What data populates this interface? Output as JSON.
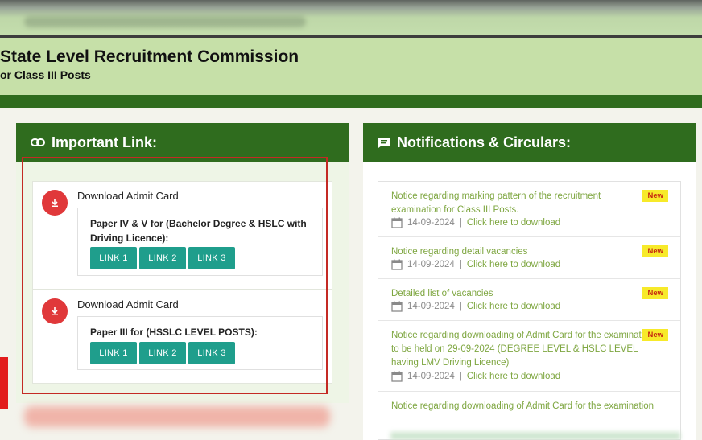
{
  "header": {
    "title": "State Level Recruitment Commission",
    "subtitle": "or Class III Posts"
  },
  "left_panel": {
    "heading": "Important Link:",
    "cards": [
      {
        "title": "Download Admit Card",
        "description": "Paper IV & V for (Bachelor Degree & HSLC with Driving Licence):",
        "links": [
          "LINK 1",
          "LINK 2",
          "LINK 3"
        ]
      },
      {
        "title": "Download Admit Card",
        "description": "Paper III for (HSSLC LEVEL POSTS):",
        "links": [
          "LINK 1",
          "LINK 2",
          "LINK 3"
        ]
      }
    ]
  },
  "right_panel": {
    "heading": "Notifications & Circulars:",
    "notices": [
      {
        "text": "Notice regarding marking pattern of the recruitment examination for Class III Posts.",
        "badge": "New",
        "date": "14-09-2024",
        "separator": "|",
        "link": "Click here to download"
      },
      {
        "text": "Notice regarding detail vacancies",
        "badge": "New",
        "date": "14-09-2024",
        "separator": "|",
        "link": "Click here to download"
      },
      {
        "text": "Detailed list of vacancies",
        "badge": "New",
        "date": "14-09-2024",
        "separator": "|",
        "link": "Click here to download"
      },
      {
        "text": "Notice regarding downloading of Admit Card for the examination to be held on 29-09-2024 (DEGREE LEVEL & HSLC LEVEL having LMV Driving Licence)",
        "badge": "New",
        "date": "14-09-2024",
        "separator": "|",
        "link": "Click here to download"
      },
      {
        "text": "Notice regarding downloading of Admit Card for the examination"
      }
    ]
  },
  "colors": {
    "header_bg": "#c6e0a8",
    "panel_head": "#2f6c1e",
    "button": "#1f9e8c",
    "highlight": "#c42a24",
    "notice_text": "#7ea640",
    "badge_bg": "#f7ea2a",
    "badge_text": "#c62a10",
    "download_circle": "#e0383a"
  },
  "icons": [
    "link-icon",
    "chat-icon",
    "download-icon",
    "calendar-icon"
  ]
}
